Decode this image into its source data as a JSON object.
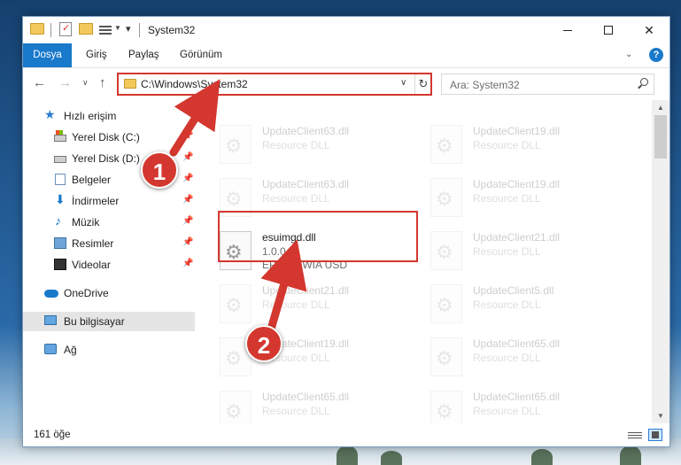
{
  "window": {
    "title": "System32"
  },
  "quick_access": {
    "customize_glyph": "▾"
  },
  "ribbon": {
    "tabs": [
      "Dosya",
      "Giriş",
      "Paylaş",
      "Görünüm"
    ],
    "help_label": "?"
  },
  "nav": {
    "address": "C:\\Windows\\System32",
    "search_placeholder": "Ara: System32"
  },
  "sidebar": {
    "items": [
      {
        "label": "Hızlı erişim",
        "icon": "star-icon",
        "pinned": false
      },
      {
        "label": "Yerel Disk (C:)",
        "icon": "drive-icon",
        "pinned": true
      },
      {
        "label": "Yerel Disk (D:)",
        "icon": "drive-icon",
        "pinned": true
      },
      {
        "label": "Belgeler",
        "icon": "documents-icon",
        "pinned": true
      },
      {
        "label": "İndirmeler",
        "icon": "download-icon",
        "pinned": true
      },
      {
        "label": "Müzik",
        "icon": "music-icon",
        "pinned": true
      },
      {
        "label": "Resimler",
        "icon": "pictures-icon",
        "pinned": true
      },
      {
        "label": "Videolar",
        "icon": "videos-icon",
        "pinned": true
      },
      {
        "label": "OneDrive",
        "icon": "cloud-icon",
        "pinned": false
      },
      {
        "label": "Bu bilgisayar",
        "icon": "computer-icon",
        "pinned": false
      },
      {
        "label": "Ağ",
        "icon": "network-icon",
        "pinned": false
      }
    ]
  },
  "files": {
    "highlighted": {
      "name": "esuimgd.dll",
      "version": "1.0.0.1",
      "description": "EPSON WIA USD"
    },
    "background": [
      {
        "name": "UpdateClient63.dll",
        "type": "Resource DLL"
      },
      {
        "name": "UpdateClient19.dll",
        "type": "Resource DLL"
      },
      {
        "name": "UpdateClient63.dll",
        "type": "Resource DLL"
      },
      {
        "name": "UpdateClient19.dll",
        "type": "Resource DLL"
      },
      {
        "name": "UpdateClient21.dll",
        "type": "Resource DLL"
      },
      {
        "name": "UpdateClient21.dll",
        "type": "Resource DLL"
      },
      {
        "name": "UpdateClient5.dll",
        "type": "Resource DLL"
      },
      {
        "name": "UpdateClient19.dll",
        "type": "Resource DLL"
      },
      {
        "name": "UpdateClient65.dll",
        "type": "Resource DLL"
      },
      {
        "name": "UpdateClient65.dll",
        "type": "Resource DLL"
      },
      {
        "name": "UpdateClient65.dll",
        "type": "Resource DLL"
      }
    ]
  },
  "status": {
    "item_count": "161 öğe"
  },
  "annotations": {
    "step1": "1",
    "step2": "2",
    "color": "#d4372f"
  }
}
